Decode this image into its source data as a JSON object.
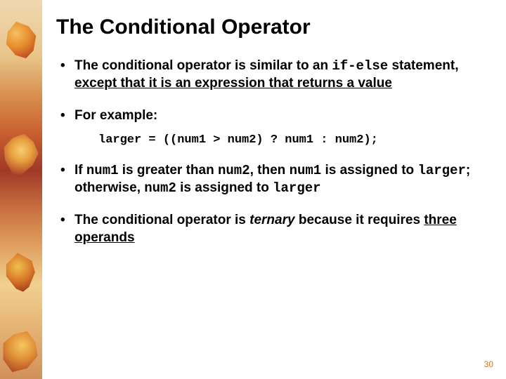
{
  "title": "The Conditional Operator",
  "bullet1": {
    "pre": "The conditional operator is similar to an ",
    "code": "if-else",
    "post": " statement, ",
    "underline": "except that it is an expression that returns a value"
  },
  "bullet2": "For example:",
  "example": "larger = ((num1 > num2) ? num1 : num2);",
  "bullet3": {
    "a": "If ",
    "n1a": "num1",
    "b": " is greater than ",
    "n2a": "num2",
    "c": ", then ",
    "n1b": "num1",
    "d": " is assigned to ",
    "lg1": "larger",
    "e": "; otherwise, ",
    "n2b": "num2",
    "f": " is assigned to ",
    "lg2": "larger"
  },
  "bullet4": {
    "a": "The conditional operator is ",
    "t": "ternary",
    "b": " because it requires ",
    "u": "three operands"
  },
  "pagenum": "30"
}
